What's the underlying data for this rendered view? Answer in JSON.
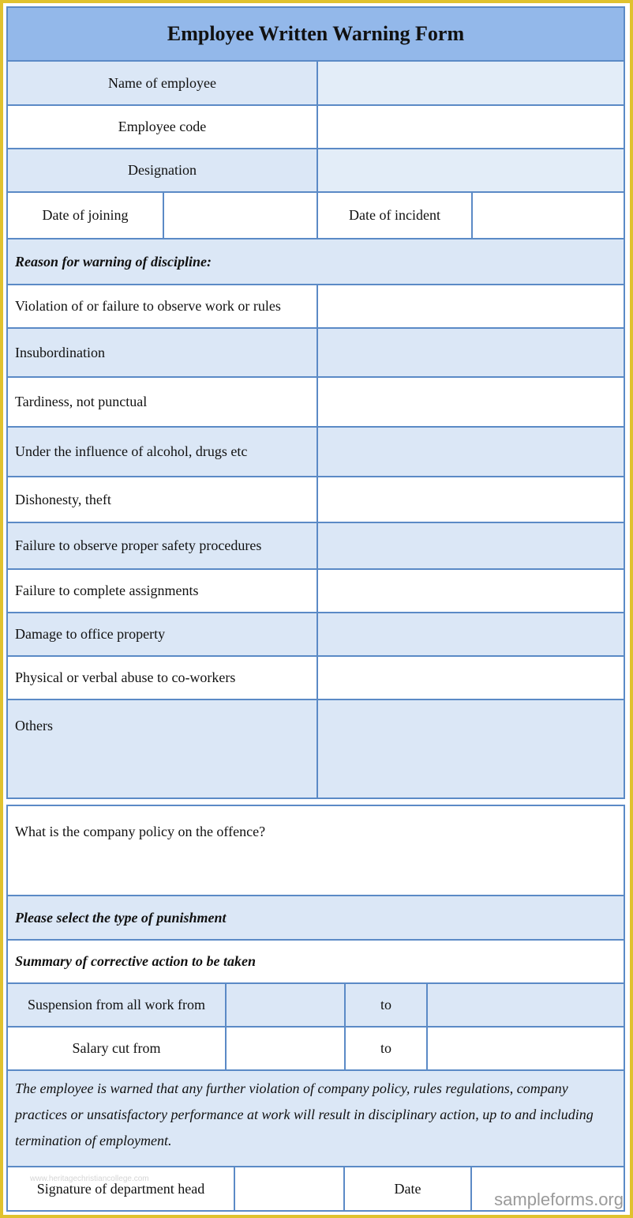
{
  "form": {
    "title": "Employee Written Warning Form",
    "fields": {
      "name_of_employee": {
        "label": "Name of employee",
        "value": ""
      },
      "employee_code": {
        "label": "Employee code",
        "value": ""
      },
      "designation": {
        "label": "Designation",
        "value": ""
      },
      "date_of_joining": {
        "label": "Date of joining",
        "value": ""
      },
      "date_of_incident": {
        "label": "Date of incident",
        "value": ""
      }
    },
    "reason_heading": "Reason for warning of discipline:",
    "reasons": [
      {
        "label": "Violation of or failure to observe work or rules",
        "value": ""
      },
      {
        "label": "Insubordination",
        "value": ""
      },
      {
        "label": "Tardiness, not punctual",
        "value": ""
      },
      {
        "label": "Under the influence of alcohol, drugs etc",
        "value": ""
      },
      {
        "label": "Dishonesty, theft",
        "value": ""
      },
      {
        "label": "Failure to observe proper safety procedures",
        "value": ""
      },
      {
        "label": "Failure to complete assignments",
        "value": ""
      },
      {
        "label": "Damage to office property",
        "value": ""
      },
      {
        "label": "Physical or verbal abuse to co-workers",
        "value": ""
      },
      {
        "label": "Others",
        "value": ""
      }
    ],
    "policy_question": "What is the company policy on the offence?",
    "punishment_heading": "Please select the type of punishment",
    "corrective_heading": "Summary of corrective action to be taken",
    "suspension": {
      "label": "Suspension from all work from",
      "to_label": "to",
      "from_value": "",
      "to_value": ""
    },
    "salary_cut": {
      "label": "Salary cut from",
      "to_label": "to",
      "from_value": "",
      "to_value": ""
    },
    "warning_text": "The employee is warned that any further violation of company policy, rules regulations, company practices or unsatisfactory performance at work will result in disciplinary action, up to and including termination of employment.",
    "signature": {
      "label": "Signature of department head",
      "value": "",
      "date_label": "Date",
      "date_value": ""
    }
  },
  "watermarks": {
    "site": "sampleforms.org",
    "faint": "www.heritagechristiancollege.com"
  },
  "colors": {
    "border": "#5b8ac6",
    "title_bg": "#93b8ea",
    "row_bg": "#dbe7f6",
    "frame": "#e0c22e"
  }
}
